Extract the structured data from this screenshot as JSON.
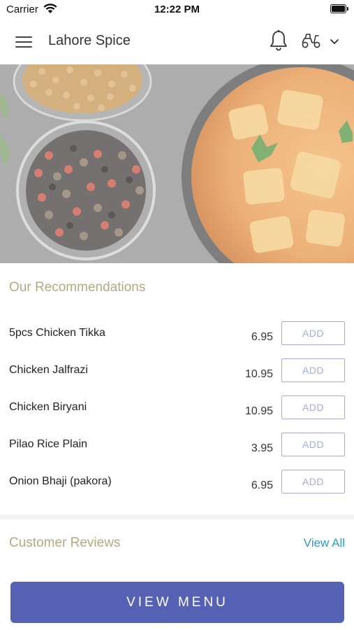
{
  "status_bar": {
    "carrier": "Carrier",
    "time": "12:22 PM"
  },
  "header": {
    "title": "Lahore Spice",
    "icons": [
      "menu-icon",
      "bell-icon",
      "scooter-icon",
      "chevron-down-icon"
    ]
  },
  "hero": {
    "image": "spices-and-curry-photo"
  },
  "recommendations": {
    "title": "Our Recommendations",
    "items": [
      {
        "name": "5pcs Chicken Tikka",
        "price": "6.95",
        "add_label": "ADD"
      },
      {
        "name": "Chicken Jalfrazi",
        "price": "10.95",
        "add_label": "ADD"
      },
      {
        "name": "Chicken Biryani",
        "price": "10.95",
        "add_label": "ADD"
      },
      {
        "name": "Pilao Rice Plain",
        "price": "3.95",
        "add_label": "ADD"
      },
      {
        "name": "Onion Bhaji (pakora)",
        "price": "6.95",
        "add_label": "ADD"
      }
    ]
  },
  "reviews": {
    "title": "Customer Reviews",
    "view_all_label": "View All"
  },
  "footer": {
    "view_menu_label": "VIEW MENU"
  },
  "colors": {
    "accent": "#5562b4",
    "section_title": "#b3a982",
    "add_button": "#a5acd8",
    "link": "#2f9cc0"
  }
}
